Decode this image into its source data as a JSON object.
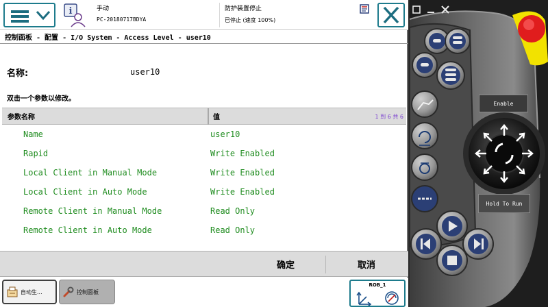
{
  "header": {
    "mode": "手动",
    "hostname": "PC-20180717BDYA",
    "guard_status": "防护装置停止",
    "speed_status": "已停止 (速度 100%)"
  },
  "breadcrumb": "控制面板 - 配置 - I/O System - Access Level - user10",
  "instance": {
    "label": "名称:",
    "value": "user10"
  },
  "instruction": "双击一个参数以修改。",
  "table": {
    "columns": [
      "参数名称",
      "值"
    ],
    "counter": "1 到 6 共 6",
    "rows": [
      {
        "param": "Name",
        "value": "user10"
      },
      {
        "param": "Rapid",
        "value": "Write Enabled"
      },
      {
        "param": "Local Client in Manual Mode",
        "value": "Write Enabled"
      },
      {
        "param": "Local Client in Auto Mode",
        "value": "Write Enabled"
      },
      {
        "param": "Remote Client in Manual Mode",
        "value": "Read Only"
      },
      {
        "param": "Remote Client in Auto Mode",
        "value": "Read Only"
      }
    ]
  },
  "actions": {
    "ok": "确定",
    "cancel": "取消"
  },
  "taskbar": {
    "items": [
      {
        "label": "自动生..."
      },
      {
        "label": "控制面板"
      }
    ],
    "quickset_label": "ROB_1"
  },
  "hardware": {
    "enable_label": "Enable",
    "hold_to_run_label": "Hold To Run"
  },
  "colors": {
    "accent": "#1d7b8c",
    "value_text": "#1f8c1f",
    "counter_text": "#7a3fd0",
    "panel_gray": "#5a5a5a",
    "button_blue": "#2f62a8",
    "emergency_red": "#e01d1d",
    "emergency_yellow": "#f2e200"
  }
}
